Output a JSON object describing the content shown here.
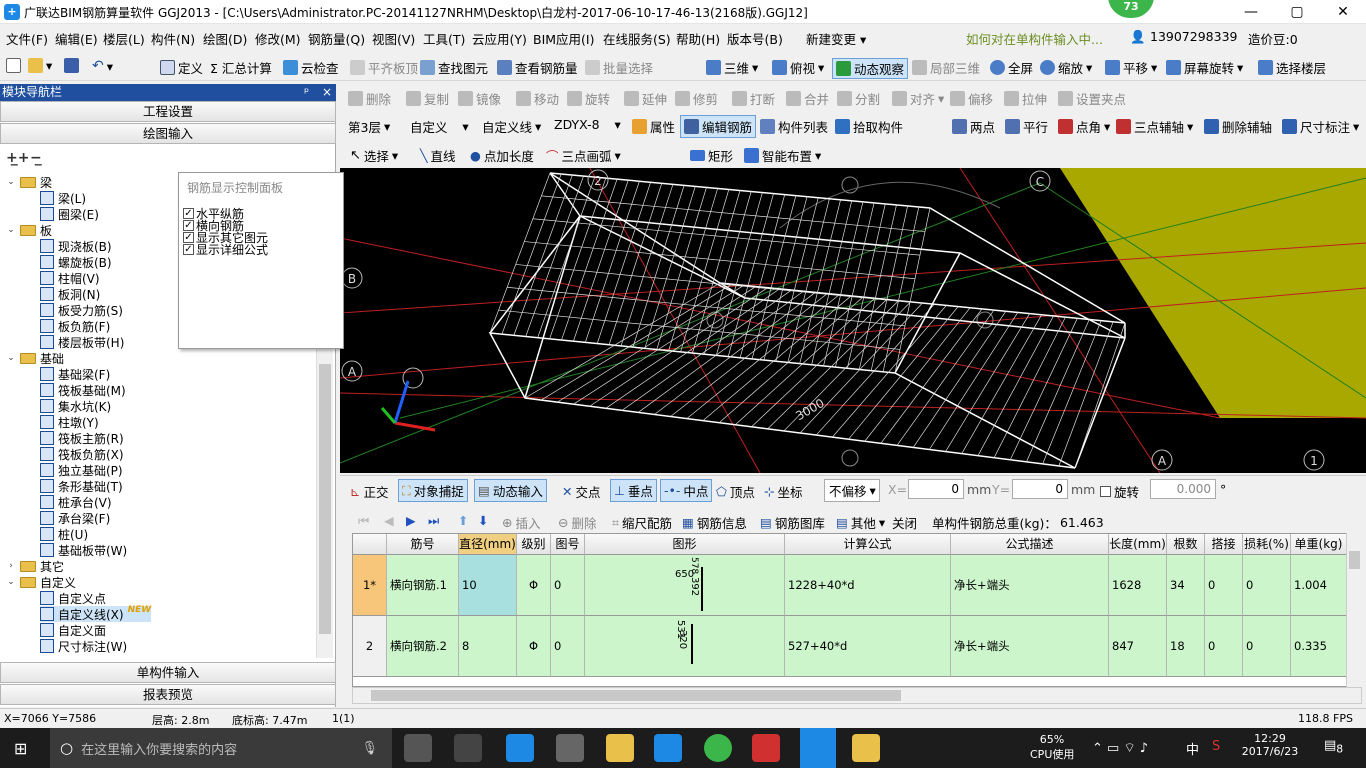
{
  "window": {
    "title": "广联达BIM钢筋算量软件 GGJ2013 - [C:\\Users\\Administrator.PC-20141127NRHM\\Desktop\\白龙村-2017-06-10-17-46-13(2168版).GGJ12]",
    "badge": "73",
    "min": "—",
    "max": "▢",
    "close": "✕"
  },
  "menu": [
    "文件(F)",
    "编辑(E)",
    "楼层(L)",
    "构件(N)",
    "绘图(D)",
    "修改(M)",
    "钢筋量(Q)",
    "视图(V)",
    "工具(T)",
    "云应用(Y)",
    "BIM应用(I)",
    "在线服务(S)",
    "帮助(H)",
    "版本号(B)",
    "新建变更 ▾"
  ],
  "menu_right": {
    "question": "如何对在单构件输入中...",
    "phone": "13907298339",
    "price": "造价豆:0"
  },
  "toolbar1": {
    "define": "定义",
    "sum": "Σ 汇总计算",
    "cloud_check": "云检查",
    "flat_top": "平齐板顶",
    "find": "查找图元",
    "view_rebar": "查看钢筋量",
    "batch_select": "批量选择",
    "three_d": "三维",
    "top_view": "俯视",
    "dynamic_view": "动态观察",
    "local_3d": "局部三维",
    "fullscreen": "全屏",
    "zoom": "缩放",
    "pan": "平移",
    "rotate_screen": "屏幕旋转",
    "select_floor": "选择楼层"
  },
  "toolbar2": {
    "delete": "删除",
    "copy": "复制",
    "mirror": "镜像",
    "move": "移动",
    "rotate": "旋转",
    "extend": "延伸",
    "trim": "修剪",
    "break": "打断",
    "merge": "合并",
    "split": "分割",
    "align": "对齐",
    "offset": "偏移",
    "stretch": "拉伸",
    "set_grip": "设置夹点"
  },
  "toolbar3": {
    "floor": "第3层",
    "type1": "自定义",
    "type2": "自定义线",
    "code": "ZDYX-8",
    "property": "属性",
    "edit_rebar": "编辑钢筋",
    "component_list": "构件列表",
    "pick": "拾取构件",
    "two_point": "两点",
    "parallel": "平行",
    "point_angle": "点角",
    "three_point_aux": "三点辅轴",
    "delete_aux": "删除辅轴",
    "dimension": "尺寸标注"
  },
  "toolbar4": {
    "select": "选择",
    "line": "直线",
    "point_length": "点加长度",
    "arc": "三点画弧",
    "rect": "矩形",
    "smart": "智能布置"
  },
  "panel": {
    "title": "模块导航栏",
    "pin": "ᵖ",
    "close": "×",
    "settings": "工程设置",
    "drawing_input": "绘图输入",
    "single_input": "单构件输入",
    "report": "报表预览"
  },
  "tree": [
    {
      "label": "梁",
      "level": 0,
      "folder": true
    },
    {
      "label": "梁(L)",
      "level": 1
    },
    {
      "label": "圈梁(E)",
      "level": 1
    },
    {
      "label": "板",
      "level": 0,
      "folder": true
    },
    {
      "label": "现浇板(B)",
      "level": 1
    },
    {
      "label": "螺旋板(B)",
      "level": 1
    },
    {
      "label": "柱帽(V)",
      "level": 1
    },
    {
      "label": "板洞(N)",
      "level": 1
    },
    {
      "label": "板受力筋(S)",
      "level": 1
    },
    {
      "label": "板负筋(F)",
      "level": 1
    },
    {
      "label": "楼层板带(H)",
      "level": 1
    },
    {
      "label": "基础",
      "level": 0,
      "folder": true
    },
    {
      "label": "基础梁(F)",
      "level": 1
    },
    {
      "label": "筏板基础(M)",
      "level": 1
    },
    {
      "label": "集水坑(K)",
      "level": 1
    },
    {
      "label": "柱墩(Y)",
      "level": 1
    },
    {
      "label": "筏板主筋(R)",
      "level": 1
    },
    {
      "label": "筏板负筋(X)",
      "level": 1
    },
    {
      "label": "独立基础(P)",
      "level": 1
    },
    {
      "label": "条形基础(T)",
      "level": 1
    },
    {
      "label": "桩承台(V)",
      "level": 1
    },
    {
      "label": "承台梁(F)",
      "level": 1
    },
    {
      "label": "桩(U)",
      "level": 1
    },
    {
      "label": "基础板带(W)",
      "level": 1
    },
    {
      "label": "其它",
      "level": 0,
      "folder": true
    },
    {
      "label": "自定义",
      "level": 0,
      "folder": true
    },
    {
      "label": "自定义点",
      "level": 1
    },
    {
      "label": "自定义线(X)",
      "level": 1
    },
    {
      "label": "自定义面",
      "level": 1
    },
    {
      "label": "尺寸标注(W)",
      "level": 1
    }
  ],
  "tree_new": "NEW",
  "popup": {
    "title": "钢筋显示控制面板",
    "items": [
      "水平纵筋",
      "横向钢筋",
      "显示其它图元",
      "显示详细公式"
    ]
  },
  "canvas": {
    "axes": [
      "2",
      "C",
      "B",
      "A",
      "A",
      "1"
    ],
    "dim": "3000"
  },
  "snapbar": {
    "ortho": "正交",
    "snap": "对象捕捉",
    "dyn_input": "动态输入",
    "intersect": "交点",
    "perp": "垂点",
    "mid": "中点",
    "vertex": "顶点",
    "coord": "坐标",
    "offset_mode": "不偏移",
    "x_label": "X=",
    "x_val": "0",
    "y_label": "Y=",
    "y_val": "0",
    "mm": "mm",
    "rotate": "旋转",
    "rotate_val": "0.000",
    "deg": "°"
  },
  "rebarbar": {
    "insert": "插入",
    "delete": "删除",
    "scale": "缩尺配筋",
    "info": "钢筋信息",
    "lib": "钢筋图库",
    "other": "其他",
    "close": "关闭",
    "total_label": "单构件钢筋总重(kg)：",
    "total": "61.463"
  },
  "grid": {
    "headers": [
      "",
      "筋号",
      "直径(mm)",
      "级别",
      "图号",
      "图形",
      "计算公式",
      "公式描述",
      "长度(mm)",
      "根数",
      "搭接",
      "损耗(%)",
      "单重(kg)"
    ],
    "rows": [
      {
        "idx": "1*",
        "name": "横向钢筋.1",
        "dia": "10",
        "grade": "Φ",
        "fig": "0",
        "shape_a": "650",
        "shape_b": "578",
        "shape_c": "392",
        "formula": "1228+40*d",
        "desc": "净长+端头",
        "len": "1628",
        "count": "34",
        "lap": "0",
        "loss": "0",
        "weight": "1.004"
      },
      {
        "idx": "2",
        "name": "横向钢筋.2",
        "dia": "8",
        "grade": "Φ",
        "fig": "0",
        "shape_a": "531",
        "shape_b": "",
        "shape_c": "320",
        "formula": "527+40*d",
        "desc": "净长+端头",
        "len": "847",
        "count": "18",
        "lap": "0",
        "loss": "0",
        "weight": "0.335"
      }
    ]
  },
  "status": {
    "coord": "X=7066 Y=7586",
    "floor_h": "层高: 2.8m",
    "base_h": "底标高: 7.47m",
    "sel": "1(1)",
    "fps": "118.8 FPS"
  },
  "taskbar": {
    "search": "在这里输入你要搜索的内容",
    "cpu_pct": "65%",
    "cpu_label": "CPU使用",
    "ime": "中",
    "time": "12:29",
    "date": "2017/6/23",
    "notif": "8"
  }
}
